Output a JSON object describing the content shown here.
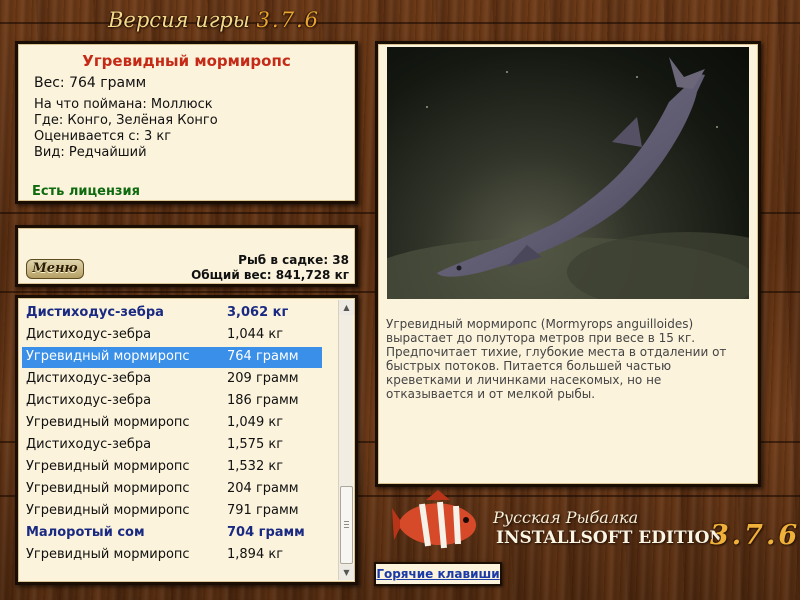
{
  "version_title": {
    "label": "Версия игры",
    "number": "3.7.6"
  },
  "fish_info": {
    "name": "Угревидный мормиропс",
    "weight": "Вес: 764 грамм",
    "bait": "На что поймана: Моллюск",
    "location": "Где: Конго, Зелёная Конго",
    "valued_from": "Оценивается с: 3 кг",
    "kind": "Вид: Редчайший",
    "license": "Есть лицензия"
  },
  "cage": {
    "menu_label": "Меню",
    "count": "Рыб в садке: 38",
    "total": "Общий вес: 841,728 кг"
  },
  "fish_list": [
    {
      "name": "Дистиходус-зебра",
      "weight": "3,062 кг",
      "bold": true,
      "selected": false
    },
    {
      "name": "Дистиходус-зебра",
      "weight": "1,044 кг",
      "bold": false,
      "selected": false
    },
    {
      "name": "Угревидный мормиропс",
      "weight": "764 грамм",
      "bold": false,
      "selected": true
    },
    {
      "name": "Дистиходус-зебра",
      "weight": "209 грамм",
      "bold": false,
      "selected": false
    },
    {
      "name": "Дистиходус-зебра",
      "weight": "186 грамм",
      "bold": false,
      "selected": false
    },
    {
      "name": "Угревидный мормиропс",
      "weight": "1,049 кг",
      "bold": false,
      "selected": false
    },
    {
      "name": "Дистиходус-зебра",
      "weight": "1,575 кг",
      "bold": false,
      "selected": false
    },
    {
      "name": "Угревидный мормиропс",
      "weight": "1,532 кг",
      "bold": false,
      "selected": false
    },
    {
      "name": "Угревидный мормиропс",
      "weight": "204 грамм",
      "bold": false,
      "selected": false
    },
    {
      "name": "Угревидный мормиропс",
      "weight": "791 грамм",
      "bold": false,
      "selected": false
    },
    {
      "name": "Малоротый сом",
      "weight": "704 грамм",
      "bold": true,
      "selected": false
    },
    {
      "name": "Угревидный мормиропс",
      "weight": "1,894 кг",
      "bold": false,
      "selected": false
    }
  ],
  "description": "Угревидный мормиропс (Mormyrops anguilloides) вырастает до полутора метров при весе в 15 кг. Предпочитает тихие, глубокие места в отдалении от быстрых потоков. Питается большей частью креветками и личинками насекомых, но не отказывается и от мелкой рыбы.",
  "logo": {
    "line1": "Русская Рыбалка",
    "line2": "INSTALLSOFT EDITION",
    "version": "3.7.6"
  },
  "hotkeys_label": "Горячие клавиши",
  "icons": {
    "scroll_up": "chevron-up-icon",
    "scroll_down": "chevron-down-icon",
    "logo_fish": "fish-icon"
  },
  "colors": {
    "title_red": "#c52a17",
    "license_green": "#0e6a0e",
    "selection_blue": "#3a8fe8",
    "bold_row_blue": "#1a2a82"
  }
}
